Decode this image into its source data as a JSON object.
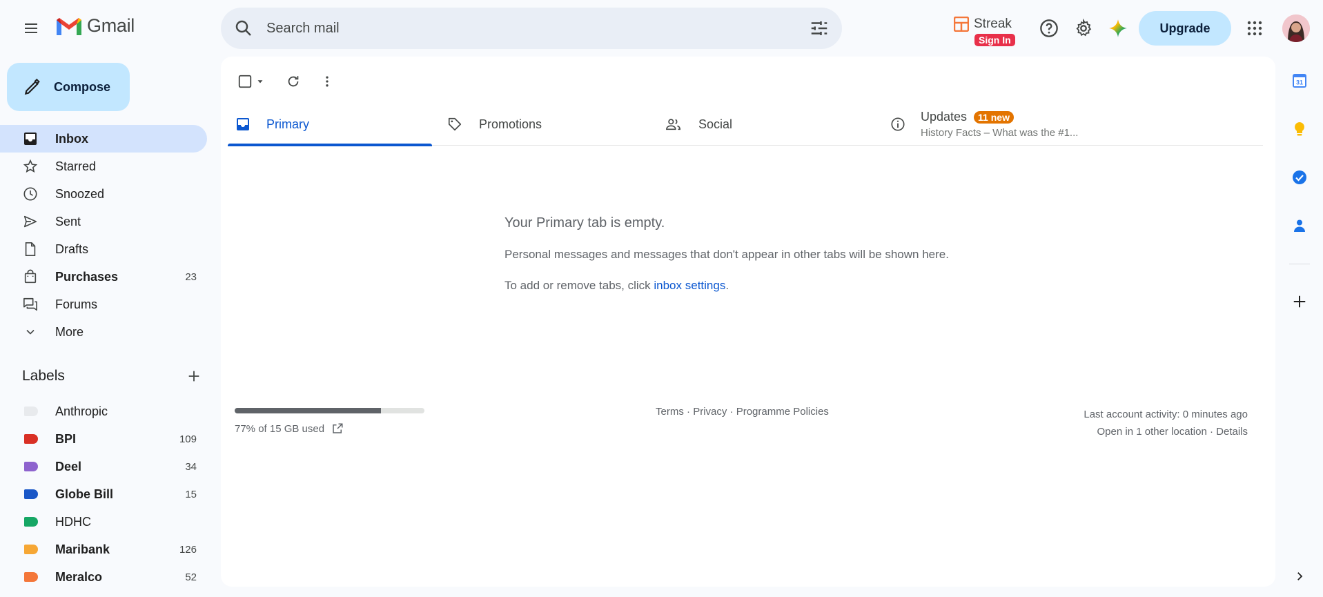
{
  "app": {
    "name": "Gmail"
  },
  "search": {
    "placeholder": "Search mail"
  },
  "header": {
    "streak_label": "Streak",
    "streak_signin": "Sign In",
    "upgrade_label": "Upgrade"
  },
  "compose": {
    "label": "Compose"
  },
  "nav": {
    "items": [
      {
        "label": "Inbox",
        "count": "",
        "icon": "inbox-icon",
        "active": true,
        "bold": true
      },
      {
        "label": "Starred",
        "count": "",
        "icon": "star-icon"
      },
      {
        "label": "Snoozed",
        "count": "",
        "icon": "clock-icon"
      },
      {
        "label": "Sent",
        "count": "",
        "icon": "send-icon"
      },
      {
        "label": "Drafts",
        "count": "",
        "icon": "draft-icon"
      },
      {
        "label": "Purchases",
        "count": "23",
        "icon": "shopping-bag-icon",
        "bold": true
      },
      {
        "label": "Forums",
        "count": "",
        "icon": "forum-icon"
      },
      {
        "label": "More",
        "count": "",
        "icon": "chevron-down-icon"
      }
    ]
  },
  "labels": {
    "title": "Labels",
    "items": [
      {
        "label": "Anthropic",
        "count": "",
        "color": "#e8eaed"
      },
      {
        "label": "BPI",
        "count": "109",
        "color": "#d93025"
      },
      {
        "label": "Deel",
        "count": "34",
        "color": "#8e63ce"
      },
      {
        "label": "Globe Bill",
        "count": "15",
        "color": "#1a57c7"
      },
      {
        "label": "HDHC",
        "count": "",
        "color": "#16a765"
      },
      {
        "label": "Maribank",
        "count": "126",
        "color": "#f6a735"
      },
      {
        "label": "Meralco",
        "count": "52",
        "color": "#f4773a"
      }
    ]
  },
  "tabs": [
    {
      "label": "Primary",
      "icon": "inbox-tab-icon",
      "active": true
    },
    {
      "label": "Promotions",
      "icon": "tag-icon"
    },
    {
      "label": "Social",
      "icon": "people-icon"
    },
    {
      "label": "Updates",
      "icon": "info-icon",
      "badge": "11 new",
      "snippet": "History Facts – What was the #1..."
    }
  ],
  "empty_state": {
    "title": "Your Primary tab is empty.",
    "line1": "Personal messages and messages that don't appear in other tabs will be shown here.",
    "line2_prefix": "To add or remove tabs, click ",
    "line2_link": "inbox settings",
    "line2_suffix": "."
  },
  "footer": {
    "storage_text": "77% of 15 GB used",
    "storage_fraction": 0.77,
    "terms": "Terms",
    "privacy": "Privacy",
    "policies": "Programme Policies",
    "sep": " · ",
    "activity": "Last account activity: 0 minutes ago",
    "open_location": "Open in 1 other location",
    "details": "Details"
  },
  "colors": {
    "accent": "#0b57d0",
    "compose_bg": "#c2e7ff",
    "active_nav_bg": "#d3e3fd",
    "badge_orange": "#e37400"
  }
}
